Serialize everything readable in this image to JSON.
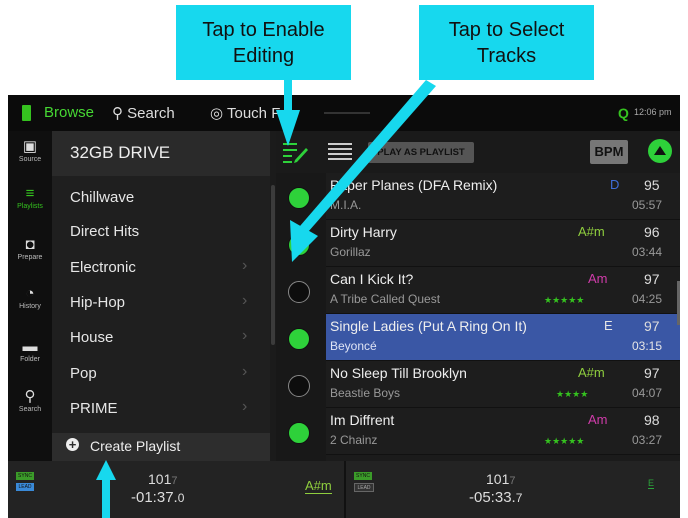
{
  "callouts": {
    "editing": {
      "line1": "Tap to Enable",
      "line2": "Editing"
    },
    "select": {
      "line1": "Tap to Select",
      "line2": "Tracks"
    }
  },
  "topbar": {
    "tabs": [
      "Browse",
      "Search",
      "Touch F"
    ],
    "clock": "12:06 pm"
  },
  "sidebar": [
    {
      "icon": "source-icon",
      "label": "Source"
    },
    {
      "icon": "playlists-icon",
      "label": "Playlists"
    },
    {
      "icon": "prepare-icon",
      "label": "Prepare"
    },
    {
      "icon": "history-icon",
      "label": "History"
    },
    {
      "icon": "folder-icon",
      "label": "Folder"
    },
    {
      "icon": "search-icon",
      "label": "Search"
    }
  ],
  "playlists": {
    "drive": "32GB DRIVE",
    "items": [
      "Chillwave",
      "Direct Hits",
      "Electronic",
      "Hip-Hop",
      "House",
      "Pop",
      "PRIME"
    ],
    "create_label": "Create Playlist"
  },
  "toolbar": {
    "play_as_playlist": "PLAY AS PLAYLIST",
    "bpm": "BPM"
  },
  "tracks": [
    {
      "title": "Paper Planes (DFA Remix)",
      "artist": "M.I.A.",
      "key": "D",
      "bpm": "95",
      "time": "05:57",
      "stars": "",
      "selected": true
    },
    {
      "title": "Dirty Harry",
      "artist": "Gorillaz",
      "key": "A#m",
      "bpm": "96",
      "time": "03:44",
      "stars": "",
      "selected": true
    },
    {
      "title": "Can I Kick It?",
      "artist": "A Tribe Called Quest",
      "key": "Am",
      "bpm": "97",
      "time": "04:25",
      "stars": "★★★★★",
      "selected": false
    },
    {
      "title": "Single Ladies (Put A Ring On It)",
      "artist": "Beyoncé",
      "key": "E",
      "bpm": "97",
      "time": "03:15",
      "stars": "",
      "selected": true
    },
    {
      "title": "No Sleep Till Brooklyn",
      "artist": "Beastie Boys",
      "key": "A#m",
      "bpm": "97",
      "time": "04:07",
      "stars": "★★★★",
      "selected": false
    },
    {
      "title": "Im Diffrent",
      "artist": "2 Chainz",
      "key": "Am",
      "bpm": "98",
      "time": "03:27",
      "stars": "★★★★★",
      "selected": true
    }
  ],
  "decks": [
    {
      "sync": "SYNC",
      "role": "LEAD",
      "bpm_main": "101",
      "bpm_frac": "7",
      "time_main": "-01:37.",
      "time_frac": "0",
      "key": "A#m"
    },
    {
      "sync": "SYNC",
      "role": "LEAD",
      "bpm_main": "101",
      "bpm_frac": "7",
      "time_main": "-05:33.",
      "time_frac": "7",
      "key": "E"
    }
  ],
  "colors": {
    "accent": "#17d8ee",
    "green": "#2ed13a",
    "selected_row": "#3a57a5",
    "key_green": "#8fce3e",
    "key_magenta": "#d03caa"
  }
}
